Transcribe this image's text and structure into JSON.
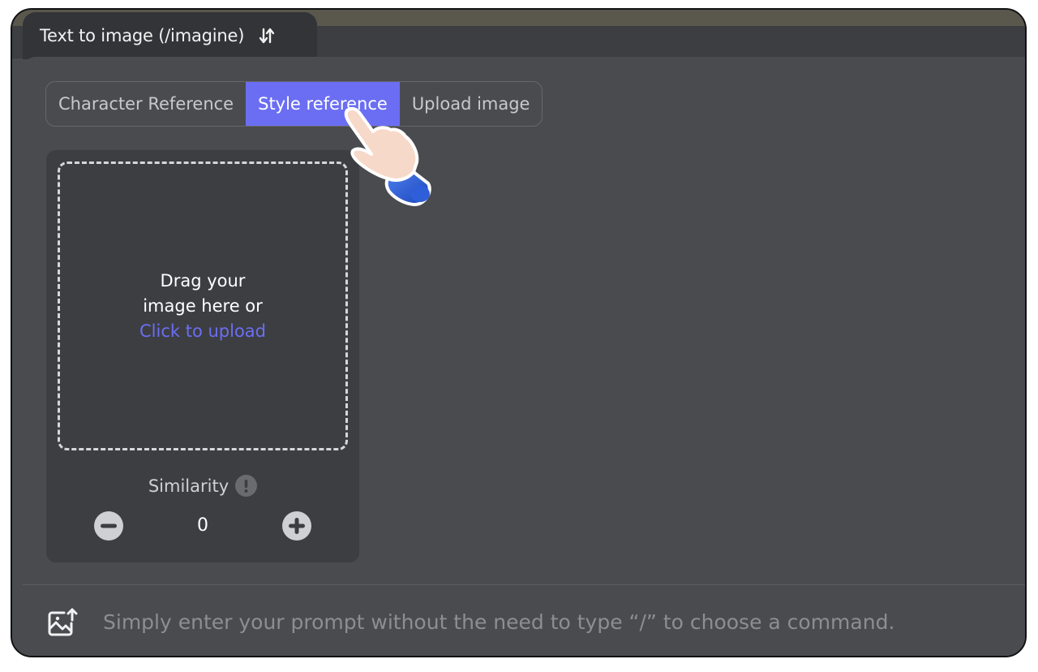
{
  "header": {
    "title": "Text to image (/imagine)",
    "swap_icon": "swap-vertical-icon"
  },
  "reference_tabs": [
    {
      "label": "Character Reference",
      "active": false
    },
    {
      "label": "Style reference",
      "active": true
    },
    {
      "label": "Upload image",
      "active": false
    }
  ],
  "upload": {
    "line1": "Drag your",
    "line2": "image here or",
    "link": "Click to upload"
  },
  "similarity": {
    "label": "Similarity",
    "value": "0"
  },
  "prompt": {
    "placeholder": "Simply enter your prompt without the need to type “/” to choose a command."
  },
  "colors": {
    "accent": "#6b6ef3",
    "panel": "#4a4b4f",
    "card": "#3d3e42"
  }
}
